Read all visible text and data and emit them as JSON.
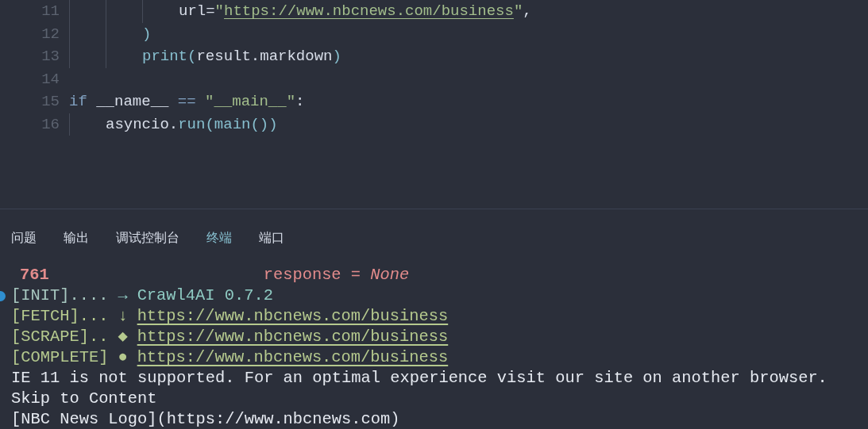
{
  "editor": {
    "lines": [
      {
        "number": "11",
        "tokens": [
          {
            "text": "            url=",
            "kind": "plain"
          },
          {
            "text": "\"",
            "kind": "string"
          },
          {
            "text": "https://www.nbcnews.com/business",
            "kind": "link"
          },
          {
            "text": "\"",
            "kind": "string"
          },
          {
            "text": ",",
            "kind": "plain"
          }
        ]
      },
      {
        "number": "12",
        "tokens": [
          {
            "text": "        )",
            "kind": "function"
          }
        ]
      },
      {
        "number": "13",
        "tokens": [
          {
            "text": "        print",
            "kind": "function"
          },
          {
            "text": "(",
            "kind": "function"
          },
          {
            "text": "result.markdown",
            "kind": "plain"
          },
          {
            "text": ")",
            "kind": "function"
          }
        ]
      },
      {
        "number": "14"
      },
      {
        "number": "15",
        "tokens": [
          {
            "text": "if",
            "kind": "keyword"
          },
          {
            "text": " __name__ ",
            "kind": "plain"
          },
          {
            "text": "==",
            "kind": "keyword"
          },
          {
            "text": " \"__main__\"",
            "kind": "string"
          },
          {
            "text": ":",
            "kind": "plain"
          }
        ]
      },
      {
        "number": "16",
        "tokens": [
          {
            "text": "    asyncio.",
            "kind": "plain"
          },
          {
            "text": "run",
            "kind": "function"
          },
          {
            "text": "(main())",
            "kind": "function"
          }
        ]
      }
    ]
  },
  "panel": {
    "tabs": [
      {
        "label": "问题",
        "selected": false
      },
      {
        "label": "输出",
        "selected": false
      },
      {
        "label": "调试控制台",
        "selected": false
      },
      {
        "label": "终端",
        "selected": true
      },
      {
        "label": "端口",
        "selected": false
      }
    ],
    "terminal": [
      {
        "marker": false,
        "segments": [
          {
            "text": "761",
            "kind": "lineno"
          },
          {
            "text": "response = *None*",
            "kind": "error"
          }
        ]
      },
      {
        "marker": true,
        "segments": [
          {
            "text": "[INIT]....",
            "kind": "tag"
          },
          {
            "text": "→",
            "kind": "info"
          },
          {
            "text": "Crawl4AI 0.7.2",
            "kind": "info"
          }
        ]
      },
      {
        "marker": false,
        "segments": [
          {
            "text": "[FETCH]...",
            "kind": "ok"
          },
          {
            "text": "↓",
            "kind": "ok"
          },
          {
            "text": "https://www.nbcnews.com/business",
            "kind": "link"
          }
        ]
      },
      {
        "marker": false,
        "segments": [
          {
            "text": "[SCRAPE]..",
            "kind": "ok"
          },
          {
            "text": "◆",
            "kind": "ok"
          },
          {
            "text": "https://www.nbcnews.com/business",
            "kind": "link"
          }
        ]
      },
      {
        "marker": false,
        "segments": [
          {
            "text": "[COMPLETE]",
            "kind": "ok"
          },
          {
            "text": "●",
            "kind": "ok"
          },
          {
            "text": "https://www.nbcnews.com/business",
            "kind": "link"
          }
        ]
      },
      {
        "marker": false,
        "segments": [
          {
            "text": "IE 11 is not supported. For an optimal experience visit our site on another browser.",
            "kind": "plain"
          }
        ]
      },
      {
        "marker": false,
        "segments": [
          {
            "text": "Skip to Content",
            "kind": "plain"
          }
        ]
      },
      {
        "marker": false,
        "segments": [
          {
            "text": "[NBC News Logo](https://www.nbcnews.com)",
            "kind": "plain"
          }
        ]
      }
    ]
  }
}
